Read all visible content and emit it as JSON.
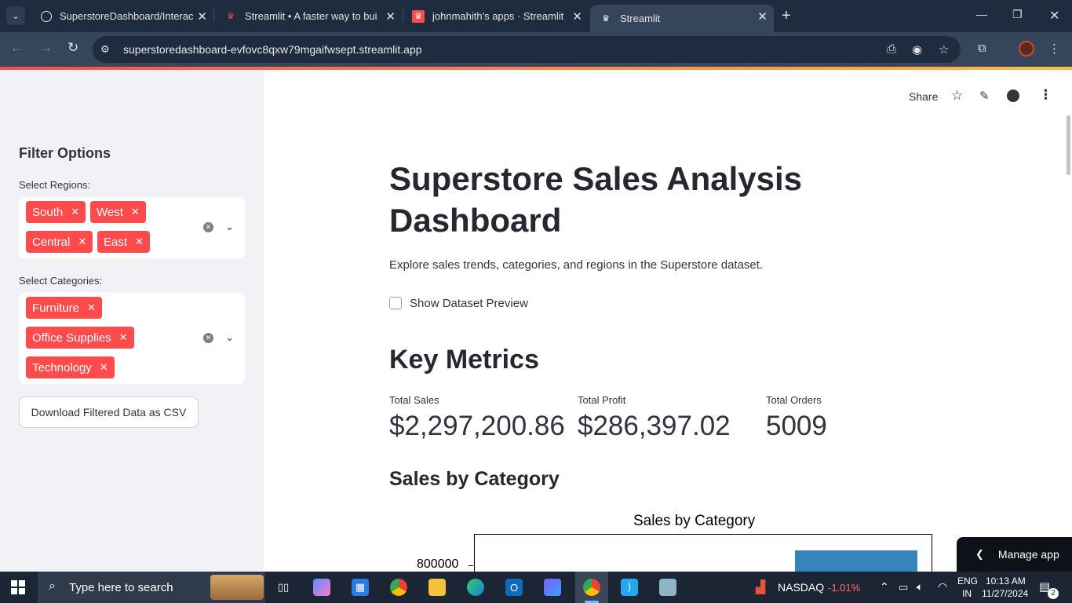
{
  "browser": {
    "tabs": [
      {
        "title": "SuperstoreDashboard/Interactiv",
        "favicon": "github-icon"
      },
      {
        "title": "Streamlit • A faster way to build",
        "favicon": "streamlit-icon"
      },
      {
        "title": "johnmahith's apps · Streamlit",
        "favicon": "streamlit-icon"
      },
      {
        "title": "Streamlit",
        "favicon": "streamlit-icon",
        "active": true
      }
    ],
    "url": "superstoredashboard-evfovc8qxw79mgaifwsept.streamlit.app"
  },
  "app_header": {
    "share_label": "Share"
  },
  "sidebar": {
    "title": "Filter Options",
    "regions": {
      "label": "Select Regions:",
      "selected": [
        "South",
        "West",
        "Central",
        "East"
      ]
    },
    "categories": {
      "label": "Select Categories:",
      "selected": [
        "Furniture",
        "Office Supplies",
        "Technology"
      ]
    },
    "download_label": "Download Filtered Data as CSV"
  },
  "main": {
    "title": "Superstore Sales Analysis Dashboard",
    "intro": "Explore sales trends, categories, and regions in the Superstore dataset.",
    "preview_checkbox_label": "Show Dataset Preview",
    "preview_checked": false,
    "metrics_heading": "Key Metrics",
    "metrics": [
      {
        "label": "Total Sales",
        "value": "$2,297,200.86"
      },
      {
        "label": "Total Profit",
        "value": "$286,397.02"
      },
      {
        "label": "Total Orders",
        "value": "5009"
      }
    ],
    "sales_by_category_heading": "Sales by Category"
  },
  "chart_data": {
    "type": "bar",
    "title": "Sales by Category",
    "y_tick_labels": [
      "800000"
    ],
    "bar_color": "#1f77b4"
  },
  "manage_app_label": "Manage app",
  "taskbar": {
    "search_placeholder": "Type here to search",
    "stock_name": "NASDAQ",
    "stock_change": "-1.01%",
    "lang_line1": "ENG",
    "lang_line2": "IN",
    "time": "10:13 AM",
    "date": "11/27/2024",
    "notification_count": "2"
  }
}
